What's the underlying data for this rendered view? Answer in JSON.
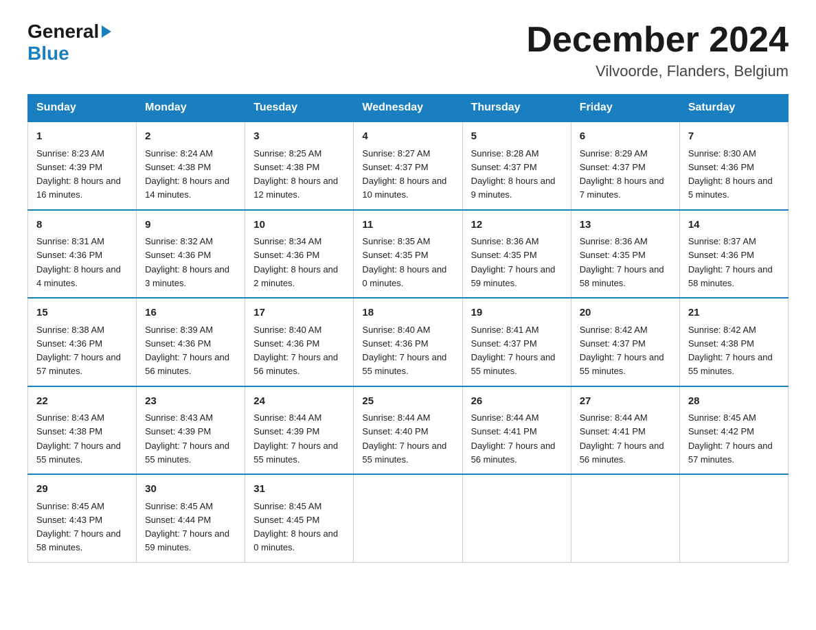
{
  "logo": {
    "general": "General",
    "blue": "Blue"
  },
  "title": "December 2024",
  "location": "Vilvoorde, Flanders, Belgium",
  "headers": [
    "Sunday",
    "Monday",
    "Tuesday",
    "Wednesday",
    "Thursday",
    "Friday",
    "Saturday"
  ],
  "weeks": [
    [
      {
        "day": "1",
        "sunrise": "8:23 AM",
        "sunset": "4:39 PM",
        "daylight": "8 hours and 16 minutes."
      },
      {
        "day": "2",
        "sunrise": "8:24 AM",
        "sunset": "4:38 PM",
        "daylight": "8 hours and 14 minutes."
      },
      {
        "day": "3",
        "sunrise": "8:25 AM",
        "sunset": "4:38 PM",
        "daylight": "8 hours and 12 minutes."
      },
      {
        "day": "4",
        "sunrise": "8:27 AM",
        "sunset": "4:37 PM",
        "daylight": "8 hours and 10 minutes."
      },
      {
        "day": "5",
        "sunrise": "8:28 AM",
        "sunset": "4:37 PM",
        "daylight": "8 hours and 9 minutes."
      },
      {
        "day": "6",
        "sunrise": "8:29 AM",
        "sunset": "4:37 PM",
        "daylight": "8 hours and 7 minutes."
      },
      {
        "day": "7",
        "sunrise": "8:30 AM",
        "sunset": "4:36 PM",
        "daylight": "8 hours and 5 minutes."
      }
    ],
    [
      {
        "day": "8",
        "sunrise": "8:31 AM",
        "sunset": "4:36 PM",
        "daylight": "8 hours and 4 minutes."
      },
      {
        "day": "9",
        "sunrise": "8:32 AM",
        "sunset": "4:36 PM",
        "daylight": "8 hours and 3 minutes."
      },
      {
        "day": "10",
        "sunrise": "8:34 AM",
        "sunset": "4:36 PM",
        "daylight": "8 hours and 2 minutes."
      },
      {
        "day": "11",
        "sunrise": "8:35 AM",
        "sunset": "4:35 PM",
        "daylight": "8 hours and 0 minutes."
      },
      {
        "day": "12",
        "sunrise": "8:36 AM",
        "sunset": "4:35 PM",
        "daylight": "7 hours and 59 minutes."
      },
      {
        "day": "13",
        "sunrise": "8:36 AM",
        "sunset": "4:35 PM",
        "daylight": "7 hours and 58 minutes."
      },
      {
        "day": "14",
        "sunrise": "8:37 AM",
        "sunset": "4:36 PM",
        "daylight": "7 hours and 58 minutes."
      }
    ],
    [
      {
        "day": "15",
        "sunrise": "8:38 AM",
        "sunset": "4:36 PM",
        "daylight": "7 hours and 57 minutes."
      },
      {
        "day": "16",
        "sunrise": "8:39 AM",
        "sunset": "4:36 PM",
        "daylight": "7 hours and 56 minutes."
      },
      {
        "day": "17",
        "sunrise": "8:40 AM",
        "sunset": "4:36 PM",
        "daylight": "7 hours and 56 minutes."
      },
      {
        "day": "18",
        "sunrise": "8:40 AM",
        "sunset": "4:36 PM",
        "daylight": "7 hours and 55 minutes."
      },
      {
        "day": "19",
        "sunrise": "8:41 AM",
        "sunset": "4:37 PM",
        "daylight": "7 hours and 55 minutes."
      },
      {
        "day": "20",
        "sunrise": "8:42 AM",
        "sunset": "4:37 PM",
        "daylight": "7 hours and 55 minutes."
      },
      {
        "day": "21",
        "sunrise": "8:42 AM",
        "sunset": "4:38 PM",
        "daylight": "7 hours and 55 minutes."
      }
    ],
    [
      {
        "day": "22",
        "sunrise": "8:43 AM",
        "sunset": "4:38 PM",
        "daylight": "7 hours and 55 minutes."
      },
      {
        "day": "23",
        "sunrise": "8:43 AM",
        "sunset": "4:39 PM",
        "daylight": "7 hours and 55 minutes."
      },
      {
        "day": "24",
        "sunrise": "8:44 AM",
        "sunset": "4:39 PM",
        "daylight": "7 hours and 55 minutes."
      },
      {
        "day": "25",
        "sunrise": "8:44 AM",
        "sunset": "4:40 PM",
        "daylight": "7 hours and 55 minutes."
      },
      {
        "day": "26",
        "sunrise": "8:44 AM",
        "sunset": "4:41 PM",
        "daylight": "7 hours and 56 minutes."
      },
      {
        "day": "27",
        "sunrise": "8:44 AM",
        "sunset": "4:41 PM",
        "daylight": "7 hours and 56 minutes."
      },
      {
        "day": "28",
        "sunrise": "8:45 AM",
        "sunset": "4:42 PM",
        "daylight": "7 hours and 57 minutes."
      }
    ],
    [
      {
        "day": "29",
        "sunrise": "8:45 AM",
        "sunset": "4:43 PM",
        "daylight": "7 hours and 58 minutes."
      },
      {
        "day": "30",
        "sunrise": "8:45 AM",
        "sunset": "4:44 PM",
        "daylight": "7 hours and 59 minutes."
      },
      {
        "day": "31",
        "sunrise": "8:45 AM",
        "sunset": "4:45 PM",
        "daylight": "8 hours and 0 minutes."
      },
      null,
      null,
      null,
      null
    ]
  ]
}
